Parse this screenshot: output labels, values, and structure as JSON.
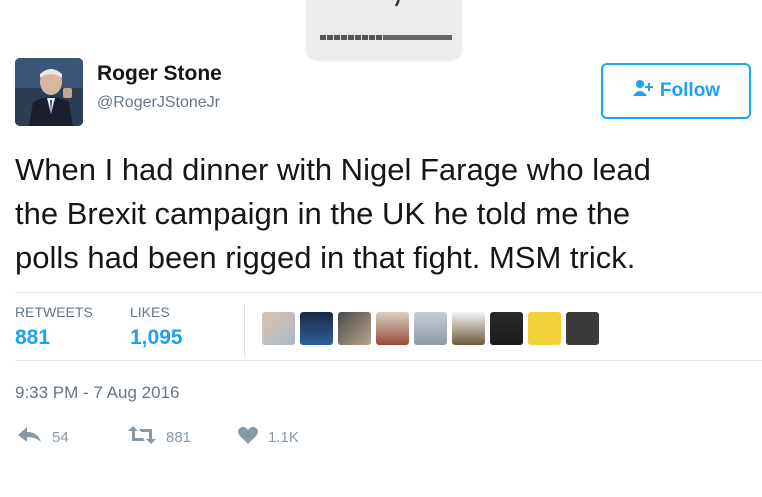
{
  "author": {
    "name": "Roger Stone",
    "handle": "@RogerJStoneJr"
  },
  "follow_button": {
    "label": "Follow",
    "icon": "add-user-icon"
  },
  "tweet": {
    "text": "When I had dinner with Nigel Farage who lead\nthe Brexit campaign in the  UK he told me the\npolls had been rigged in that fight. MSM  trick."
  },
  "stats": {
    "retweets_label": "RETWEETS",
    "retweets_value": "881",
    "likes_label": "LIKES",
    "likes_value": "1,095"
  },
  "timestamp": "9:33 PM - 7 Aug 2016",
  "actions": {
    "reply_count": "54",
    "retweet_count": "881",
    "like_count": "1.1K"
  },
  "volume_overlay": {
    "icon": "speaker-icon",
    "level": 0.48
  },
  "colors": {
    "accent": "#1da1f2",
    "muted": "#657786",
    "text": "#14171a"
  }
}
